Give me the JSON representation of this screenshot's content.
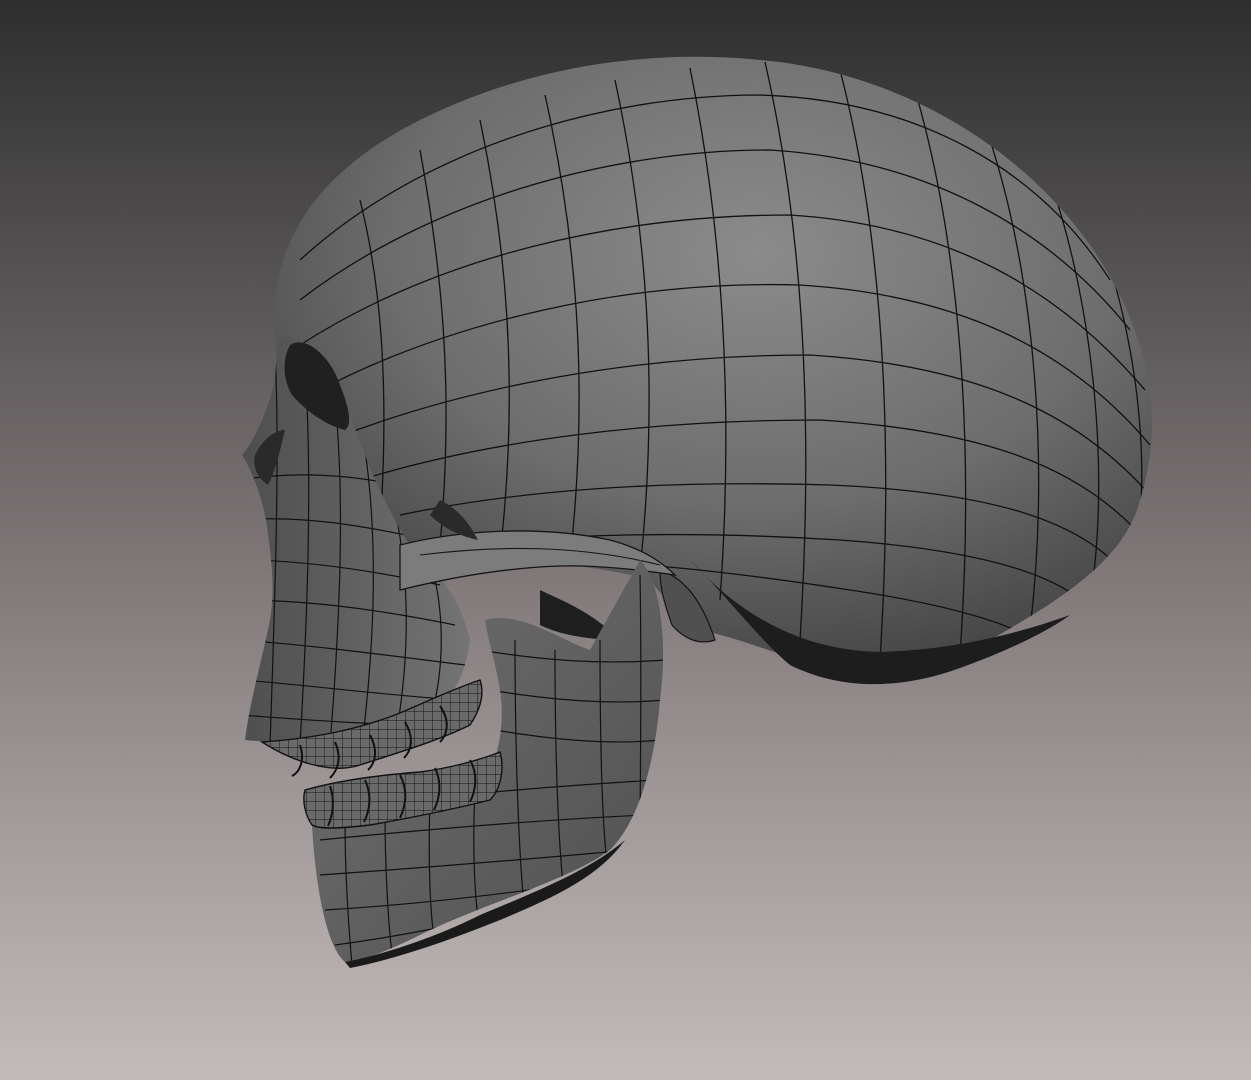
{
  "viewport": {
    "background_top": "#2e2e2f",
    "background_bottom": "#c3bbba",
    "shading_mode": "smooth-shaded-with-wireframe",
    "wire_color": "#111111"
  },
  "model": {
    "subject": "human-skull",
    "view": "left-side",
    "mandible": "open",
    "surface_color": "#6f6f6f",
    "shadow_color": "#1c1c1c"
  }
}
